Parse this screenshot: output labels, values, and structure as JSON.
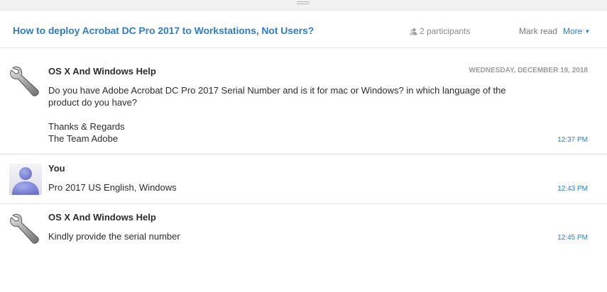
{
  "header": {
    "title": "How to deploy Acrobat DC Pro 2017 to Workstations, Not Users?",
    "participants": "2 participants",
    "mark_read": "Mark read",
    "more": "More"
  },
  "messages": [
    {
      "sender": "OS X And Windows Help",
      "date": "WEDNESDAY, DECEMBER 19, 2018",
      "paragraphs": [
        "Do you have Adobe Acrobat DC Pro 2017  Serial Number and is it for mac or Windows? in which language of the product do you have?",
        "Thanks & Regards The Team Adobe"
      ],
      "signoff": [
        "Thanks & Regards",
        "The Team Adobe"
      ],
      "time": "12:37 PM",
      "avatar": "wrench-icon"
    },
    {
      "sender": "You",
      "paragraphs": [
        "Pro 2017 US English, Windows"
      ],
      "time": "12:43 PM",
      "avatar": "user-silhouette-icon"
    },
    {
      "sender": "OS X And Windows Help",
      "paragraphs": [
        "Kindly provide the serial number"
      ],
      "time": "12:45 PM",
      "avatar": "wrench-icon"
    }
  ],
  "colors": {
    "link": "#2d7fcc",
    "text": "#2c2c2c",
    "muted": "#8a8a8a",
    "divider": "#e3e3e3",
    "avatar_user": "#7f86d6"
  }
}
